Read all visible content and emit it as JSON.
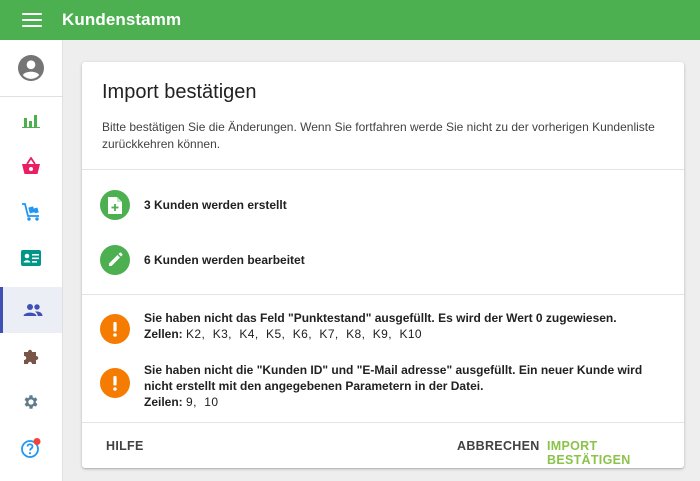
{
  "app": {
    "title": "Kundenstamm"
  },
  "sidebar": {
    "items": [
      {
        "name": "account",
        "icon": "account-circle-icon",
        "color": "#757575"
      },
      {
        "name": "statistics",
        "icon": "bar-chart-icon",
        "color": "#4caf50"
      },
      {
        "name": "shop",
        "icon": "basket-icon",
        "color": "#e91e63"
      },
      {
        "name": "delivery",
        "icon": "cart-icon",
        "color": "#2196f3"
      },
      {
        "name": "contacts",
        "icon": "contact-card-icon",
        "color": "#009688"
      },
      {
        "name": "customers",
        "icon": "people-icon",
        "color": "#3f51b5",
        "active": true
      },
      {
        "name": "plugins",
        "icon": "puzzle-icon",
        "color": "#795548"
      },
      {
        "name": "settings",
        "icon": "gear-icon",
        "color": "#607d8b"
      },
      {
        "name": "help",
        "icon": "help-icon",
        "color": "#2196f3",
        "badge_color": "#f44336"
      }
    ]
  },
  "dialog": {
    "title": "Import bestätigen",
    "description": "Bitte bestätigen Sie die Änderungen. Wenn Sie fortfahren werde Sie nicht zu der vorherigen Kundenliste zurückkehren können.",
    "summary": [
      {
        "icon": "file-plus-icon",
        "text": "3 Kunden werden erstellt",
        "color": "#4caf50"
      },
      {
        "icon": "pencil-icon",
        "text": "6 Kunden werden bearbeitet",
        "color": "#4caf50"
      }
    ],
    "warnings": [
      {
        "icon": "exclamation-icon",
        "message": "Sie haben nicht das Feld \"Punktestand\" ausgefüllt. Es wird der Wert 0 zugewiesen.",
        "cells_label": "Zellen:",
        "cells": "K2,  K3,  K4,  K5,  K6,  K7,  K8,  K9,  K10"
      },
      {
        "icon": "exclamation-icon",
        "message": "Sie haben nicht die \"Kunden ID\" und \"E-Mail adresse\" ausgefüllt. Ein neuer Kunde wird nicht erstellt mit den angegebenen Parametern in der Datei.",
        "cells_label": "Zeilen:",
        "cells": "9,  10"
      }
    ],
    "actions": {
      "help": "HILFE",
      "cancel": "ABBRECHEN",
      "confirm": "IMPORT BESTÄTIGEN"
    }
  },
  "colors": {
    "primary": "#4caf50",
    "confirm": "#8bc34a",
    "warning": "#f57c00",
    "active_nav": "#3f51b5"
  }
}
